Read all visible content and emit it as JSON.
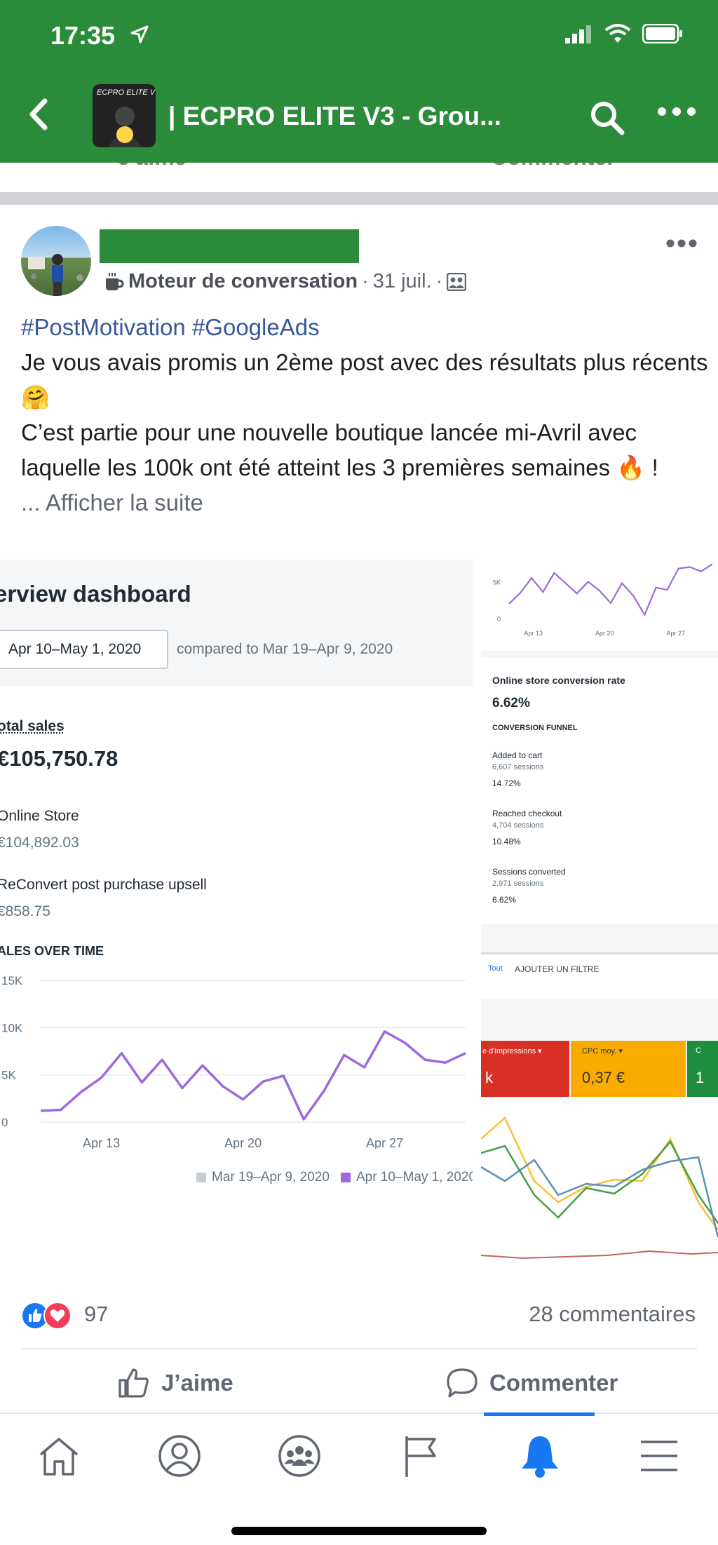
{
  "status_bar": {
    "time": "17:35"
  },
  "header": {
    "title": "| ECPRO ELITE V3 - Grou...",
    "avatar_text": "ECPRO ELITE V"
  },
  "ghost_actions": {
    "like": "J'aime",
    "comment": "Commenter"
  },
  "post": {
    "source": "Moteur de conversation",
    "date": "31 juil.",
    "dot": "·",
    "hashtags": "#PostMotivation #GoogleAds",
    "line1": "Je vous avais promis un 2ème post avec des résultats plus récents 🤗",
    "line2": "C’est partie pour une nouvelle boutique lancée mi-Avril avec laquelle les 100k ont été atteint les 3 premières semaines 🔥 !",
    "see_more": "... Afficher la suite"
  },
  "dashboard": {
    "title": "erview dashboard",
    "date_range": "Apr 10–May 1, 2020",
    "compared": "compared to Mar 19–Apr 9, 2020",
    "total_sales_label": "otal sales",
    "total_sales_value": "€105,750.78",
    "online_store_label": "Online Store",
    "online_store_value": "€104,892.03",
    "reconvert_label": "ReConvert post purchase upsell",
    "reconvert_value": "€858.75",
    "sales_over_time": "ALES OVER TIME",
    "legend_prev": "Mar 19–Apr 9, 2020",
    "legend_curr": "Apr 10–May 1, 2020",
    "legend_prev_color": "#c4cdd5",
    "legend_curr_color": "#9c6ade"
  },
  "chart_data": [
    {
      "type": "line",
      "title": "ALES OVER TIME",
      "x": [
        "Apr 10",
        "Apr 11",
        "Apr 12",
        "Apr 13",
        "Apr 14",
        "Apr 15",
        "Apr 16",
        "Apr 17",
        "Apr 18",
        "Apr 19",
        "Apr 20",
        "Apr 21",
        "Apr 22",
        "Apr 23",
        "Apr 24",
        "Apr 25",
        "Apr 26",
        "Apr 27",
        "Apr 28",
        "Apr 29",
        "Apr 30",
        "May 1"
      ],
      "xticks": [
        "Apr 13",
        "Apr 20",
        "Apr 27"
      ],
      "yticks": [
        "0",
        "5K",
        "10K",
        "15K"
      ],
      "ylim": [
        0,
        15000
      ],
      "series": [
        {
          "name": "Apr 10–May 1, 2020",
          "color": "#9c6ade",
          "values": [
            1200,
            1300,
            3200,
            4700,
            7300,
            4200,
            6600,
            3600,
            6000,
            3800,
            2400,
            4300,
            4900,
            300,
            3300,
            7100,
            5800,
            9600,
            8400,
            6600,
            6300,
            7300
          ]
        }
      ]
    },
    {
      "type": "line",
      "title": "Online store conversion rate",
      "xticks": [
        "Apr 13",
        "Apr 20",
        "Apr 27"
      ],
      "yticks": [
        "0",
        "5K"
      ],
      "series": [
        {
          "name": "",
          "color": "#9c6ade",
          "values": [
            2000,
            3500,
            5500,
            3600,
            6200,
            4800,
            3400,
            5000,
            3800,
            2100,
            4800,
            3100,
            500,
            4200,
            3900,
            6800,
            7000,
            6400,
            7400
          ]
        }
      ]
    }
  ],
  "conversion": {
    "title": "Online store conversion rate",
    "value": "6.62%",
    "funnel": "CONVERSION FUNNEL",
    "steps": [
      {
        "label": "Added to cart",
        "sessions": "6,607 sessions",
        "pct": "14.72%"
      },
      {
        "label": "Reached checkout",
        "sessions": "4,704 sessions",
        "pct": "10.48%"
      },
      {
        "label": "Sessions converted",
        "sessions": "2,971 sessions",
        "pct": "6.62%"
      }
    ]
  },
  "ads": {
    "tout": "Tout",
    "filter": "AJOUTER UN FILTRE",
    "impr_label": "e d'impressions ▾",
    "impr_value": "k",
    "cpc_label": "CPC moy. ▾",
    "cpc_value": "0,37 €",
    "third_label": "C",
    "third_value": "1",
    "colors": {
      "red": "#d93025",
      "yellow": "#f9ab00",
      "green": "#1e8e3e"
    }
  },
  "engagement": {
    "count": "97",
    "comments": "28 commentaires",
    "like": "J’aime",
    "comment": "Commenter"
  }
}
